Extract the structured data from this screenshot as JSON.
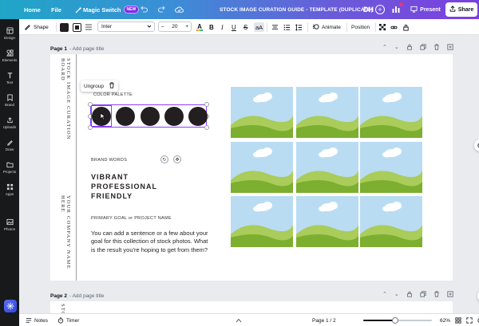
{
  "topbar": {
    "home": "Home",
    "file": "File",
    "magic_switch": "Magic Switch",
    "new_badge": "NEW",
    "doc_title": "STOCK IMAGE CURATION GUIDE - TEMPLATE (DUPLICATE)",
    "avatar_initials": "DH",
    "present": "Present",
    "share": "Share"
  },
  "rail": {
    "items": [
      "Design",
      "Elements",
      "Text",
      "Brand",
      "Uploads",
      "Draw",
      "Projects",
      "Apps",
      "Photos"
    ]
  },
  "toolbar": {
    "shape": "Shape",
    "font": "Inter",
    "font_size": "20",
    "minus": "–",
    "plus": "+",
    "bold": "B",
    "italic": "I",
    "underline": "U",
    "strike": "S",
    "case": "aA",
    "animate": "Animate",
    "position": "Position"
  },
  "canvas": {
    "page1_label": "Page 1",
    "page1_title_placeholder": "- Add page title",
    "page2_label": "Page 2",
    "page2_title_placeholder": "- Add page title",
    "vertical_title": "STOCK IMAGE CURATION BOARD",
    "vertical_company": "YOUR COMPANY NAME HERE",
    "ungroup": "Ungroup",
    "color_palette": "COLOR PALETTE",
    "brand_words_label": "BRAND WORDS",
    "brand_words": [
      "VIBRANT",
      "PROFESSIONAL",
      "FRIENDLY"
    ],
    "goal_label": "PRIMARY GOAL or PROJECT NAME",
    "goal_text": "You can add a sentence or a few about your goal for this collection of stock photos. What is the result you're hoping to get from them?"
  },
  "palette_colors": [
    "#231f20",
    "#231f20",
    "#231f20",
    "#231f20",
    "#231f20"
  ],
  "colors": {
    "accent": "#8b3dff",
    "sky": "#b9dcf2",
    "grass": "#7cae2f"
  },
  "bottombar": {
    "notes": "Notes",
    "timer": "Timer",
    "page_indicator": "Page 1 / 2",
    "zoom": "62%",
    "zoom_fraction": 0.47
  }
}
